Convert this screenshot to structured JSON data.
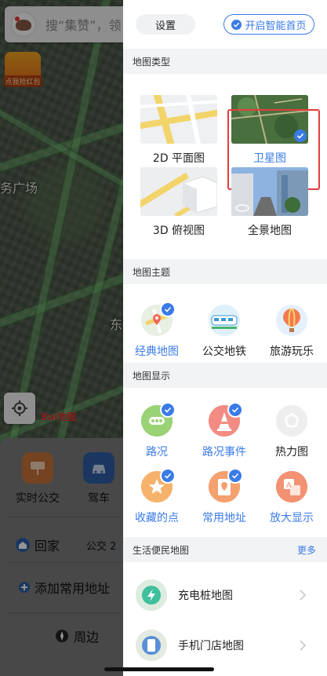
{
  "search": {
    "placeholder": "搜“集赞”，领"
  },
  "map": {
    "labels": [
      "务广场",
      "东"
    ],
    "redpacket_label": "点我抢红包",
    "logo_text": "Bai地图"
  },
  "bottom_card": {
    "items": [
      {
        "label": "实时公交",
        "icon": "bus-stop-icon"
      },
      {
        "label": "驾车",
        "icon": "car-icon"
      }
    ],
    "home": {
      "label": "回家",
      "extra": "公交 2"
    },
    "add_address": "添加常用地址",
    "nearby": "周边"
  },
  "panel": {
    "settings_label": "设置",
    "smart_home_label": "开启智能首页",
    "map_type": {
      "title": "地图类型",
      "options": [
        {
          "label": "2D 平面图",
          "selected": false
        },
        {
          "label": "卫星图",
          "selected": true
        },
        {
          "label": "3D 俯视图",
          "selected": false
        },
        {
          "label": "全景地图",
          "selected": false
        }
      ]
    },
    "map_theme": {
      "title": "地图主题",
      "options": [
        {
          "label": "经典地图",
          "selected": true
        },
        {
          "label": "公交地铁",
          "selected": false
        },
        {
          "label": "旅游玩乐",
          "selected": false
        }
      ]
    },
    "map_display": {
      "title": "地图显示",
      "options": [
        {
          "label": "路况",
          "selected": true
        },
        {
          "label": "路况事件",
          "selected": true
        },
        {
          "label": "热力图",
          "selected": false
        },
        {
          "label": "收藏的点",
          "selected": true
        },
        {
          "label": "常用地址",
          "selected": true
        },
        {
          "label": "放大显示",
          "selected": false
        }
      ]
    },
    "life_map": {
      "title": "生活便民地图",
      "more": "更多",
      "items": [
        {
          "label": "充电桩地图"
        },
        {
          "label": "手机门店地图"
        }
      ]
    }
  },
  "colors": {
    "accent": "#3a7be8",
    "highlight": "#e53b3b"
  }
}
